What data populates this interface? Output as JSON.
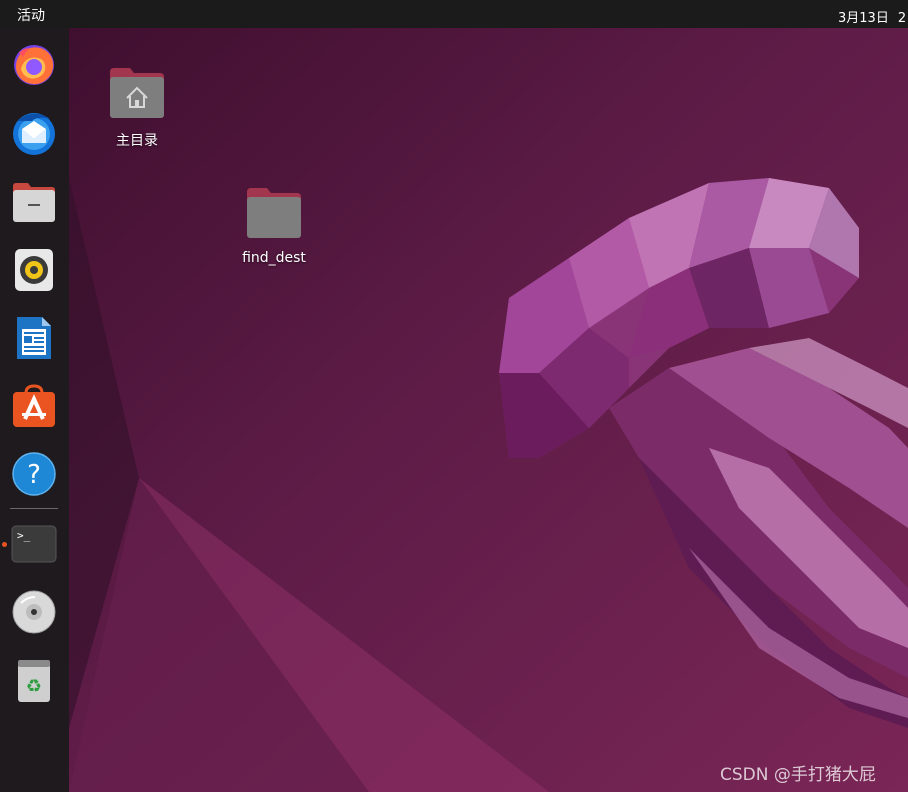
{
  "topbar": {
    "activities_label": "活动",
    "clock_text": "3月13日",
    "clock_trailing": "2"
  },
  "dock": {
    "items": [
      {
        "name": "firefox",
        "icon": "firefox-icon"
      },
      {
        "name": "thunderbird",
        "icon": "thunderbird-icon"
      },
      {
        "name": "files",
        "icon": "files-icon"
      },
      {
        "name": "rhythmbox",
        "icon": "rhythmbox-icon"
      },
      {
        "name": "libreoffice-writer",
        "icon": "libreoffice-writer-icon"
      },
      {
        "name": "ubuntu-software",
        "icon": "ubuntu-software-icon"
      },
      {
        "name": "help",
        "icon": "help-icon",
        "glyph": "?"
      },
      {
        "name": "terminal",
        "icon": "terminal-icon",
        "glyph": ">_",
        "running": true
      },
      {
        "name": "optical-disc",
        "icon": "disc-icon"
      },
      {
        "name": "trash",
        "icon": "trash-icon",
        "glyph": "♻"
      }
    ]
  },
  "desktop": {
    "icons": [
      {
        "label": "主目录",
        "icon": "home-folder-icon"
      },
      {
        "label": "find_dest",
        "icon": "folder-icon"
      }
    ]
  },
  "watermark": {
    "text": "CSDN @手打猪大屁"
  },
  "colors": {
    "topbar": "#1b1b1b",
    "dock": "#1e1a1d",
    "accent": "#e95420",
    "wallpaper_base": "#5a1d44"
  }
}
